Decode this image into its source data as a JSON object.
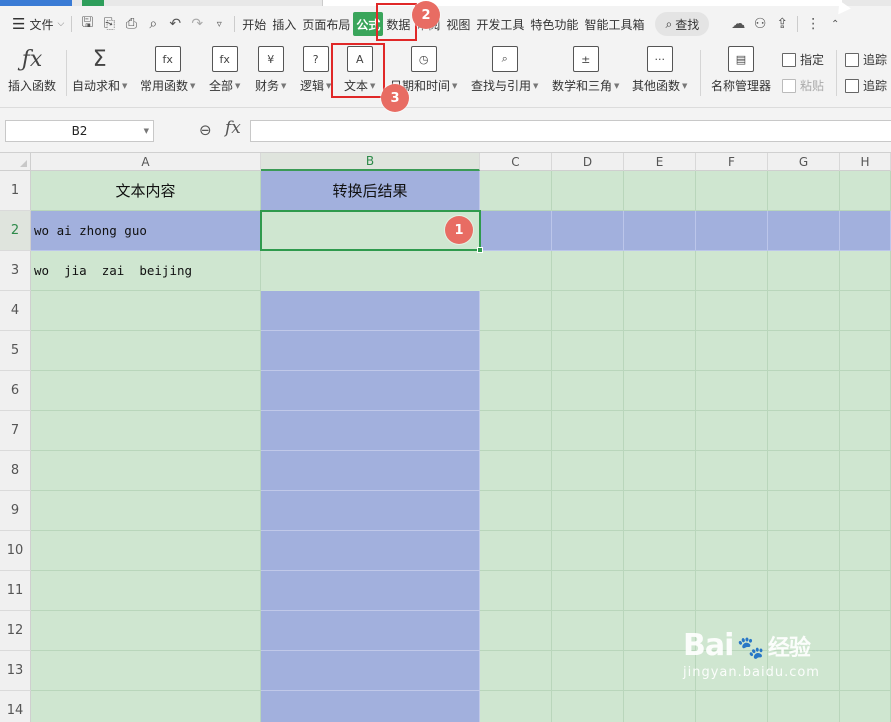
{
  "menubar": {
    "file_label": "文件",
    "tabs": [
      "开始",
      "插入",
      "页面布局",
      "公式",
      "数据",
      "审阅",
      "视图",
      "开发工具",
      "特色功能",
      "智能工具箱"
    ],
    "search_label": "查找"
  },
  "ribbon": {
    "insert_function": "插入函数",
    "autosum": "自动求和",
    "common": "常用函数",
    "all": "全部",
    "finance": "财务",
    "logic": "逻辑",
    "text": "文本",
    "datetime": "日期和时间",
    "lookup": "查找与引用",
    "math": "数学和三角",
    "other": "其他函数",
    "name_manager": "名称管理器",
    "specify": "指定",
    "paste": "粘贴",
    "trace1": "追踪",
    "trace2": "追踪"
  },
  "formula_bar": {
    "cell_ref": "B2",
    "fx": "fx",
    "value": ""
  },
  "sheet": {
    "columns": [
      "A",
      "B",
      "C",
      "D",
      "E",
      "F",
      "G",
      "H"
    ],
    "rows": [
      "1",
      "2",
      "3",
      "4",
      "5",
      "6",
      "7",
      "8",
      "9",
      "10",
      "11",
      "12",
      "13",
      "14"
    ],
    "cells": {
      "A1": "文本内容",
      "B1": "转换后结果",
      "A2": "wo ai zhong guo",
      "A3": "wo  jia  zai  beijing"
    }
  },
  "annotations": {
    "step1": "1",
    "step2": "2",
    "step3": "3"
  },
  "watermark": {
    "logo_text": "Bai",
    "logo_cn": "经验",
    "url": "jingyan.baidu.com"
  }
}
